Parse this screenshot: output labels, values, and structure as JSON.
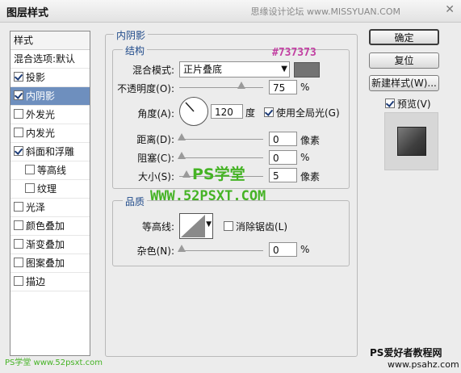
{
  "window": {
    "title": "图层样式",
    "watermark": "思缘设计论坛 www.MISSYUAN.COM"
  },
  "style_list": {
    "header": "样式",
    "items": [
      {
        "label": "混合选项:默认",
        "checkbox": false
      },
      {
        "label": "投影",
        "checkbox": true,
        "checked": true
      },
      {
        "label": "内阴影",
        "checkbox": true,
        "checked": true,
        "selected": true
      },
      {
        "label": "外发光",
        "checkbox": true,
        "checked": false
      },
      {
        "label": "内发光",
        "checkbox": true,
        "checked": false
      },
      {
        "label": "斜面和浮雕",
        "checkbox": true,
        "checked": true
      },
      {
        "label": "等高线",
        "checkbox": true,
        "checked": false,
        "sub": true
      },
      {
        "label": "纹理",
        "checkbox": true,
        "checked": false,
        "sub": true
      },
      {
        "label": "光泽",
        "checkbox": true,
        "checked": false
      },
      {
        "label": "颜色叠加",
        "checkbox": true,
        "checked": false
      },
      {
        "label": "渐变叠加",
        "checkbox": true,
        "checked": false
      },
      {
        "label": "图案叠加",
        "checkbox": true,
        "checked": false
      },
      {
        "label": "描边",
        "checkbox": true,
        "checked": false
      }
    ]
  },
  "panel": {
    "title": "内阴影",
    "structure": {
      "title": "结构",
      "blend_mode_label": "混合模式:",
      "blend_mode_value": "正片叠底",
      "color_annotation": "#737373",
      "color_swatch": "#737373",
      "opacity_label": "不透明度(O):",
      "opacity_value": "75",
      "opacity_unit": "%",
      "angle_label": "角度(A):",
      "angle_value": "120",
      "angle_unit": "度",
      "global_light_label": "使用全局光(G)",
      "global_light_checked": true,
      "distance_label": "距离(D):",
      "distance_value": "0",
      "distance_unit": "像素",
      "choke_label": "阻塞(C):",
      "choke_value": "0",
      "choke_unit": "%",
      "size_label": "大小(S):",
      "size_value": "5",
      "size_unit": "像素"
    },
    "quality": {
      "title": "品质",
      "contour_label": "等高线:",
      "anti_alias_label": "消除锯齿(L)",
      "anti_alias_checked": false,
      "noise_label": "杂色(N):",
      "noise_value": "0",
      "noise_unit": "%"
    }
  },
  "buttons": {
    "ok": "确定",
    "reset": "复位",
    "new_style": "新建样式(W)...",
    "preview_label": "预览(V)",
    "preview_checked": true
  },
  "watermarks": {
    "ps_school": "PS学堂",
    "site": "WWW.52PSXT.COM",
    "bottom_left": "PS学堂 www.52psxt.com",
    "bottom_right_1": "PS爱好者教程网",
    "bottom_right_2": "www.psahz.com"
  },
  "colors": {
    "selection": "#6e8fbe",
    "accent_blue": "#1f4a8a",
    "annotation_pink": "#c23fa2",
    "watermark_green": "#45b325"
  }
}
